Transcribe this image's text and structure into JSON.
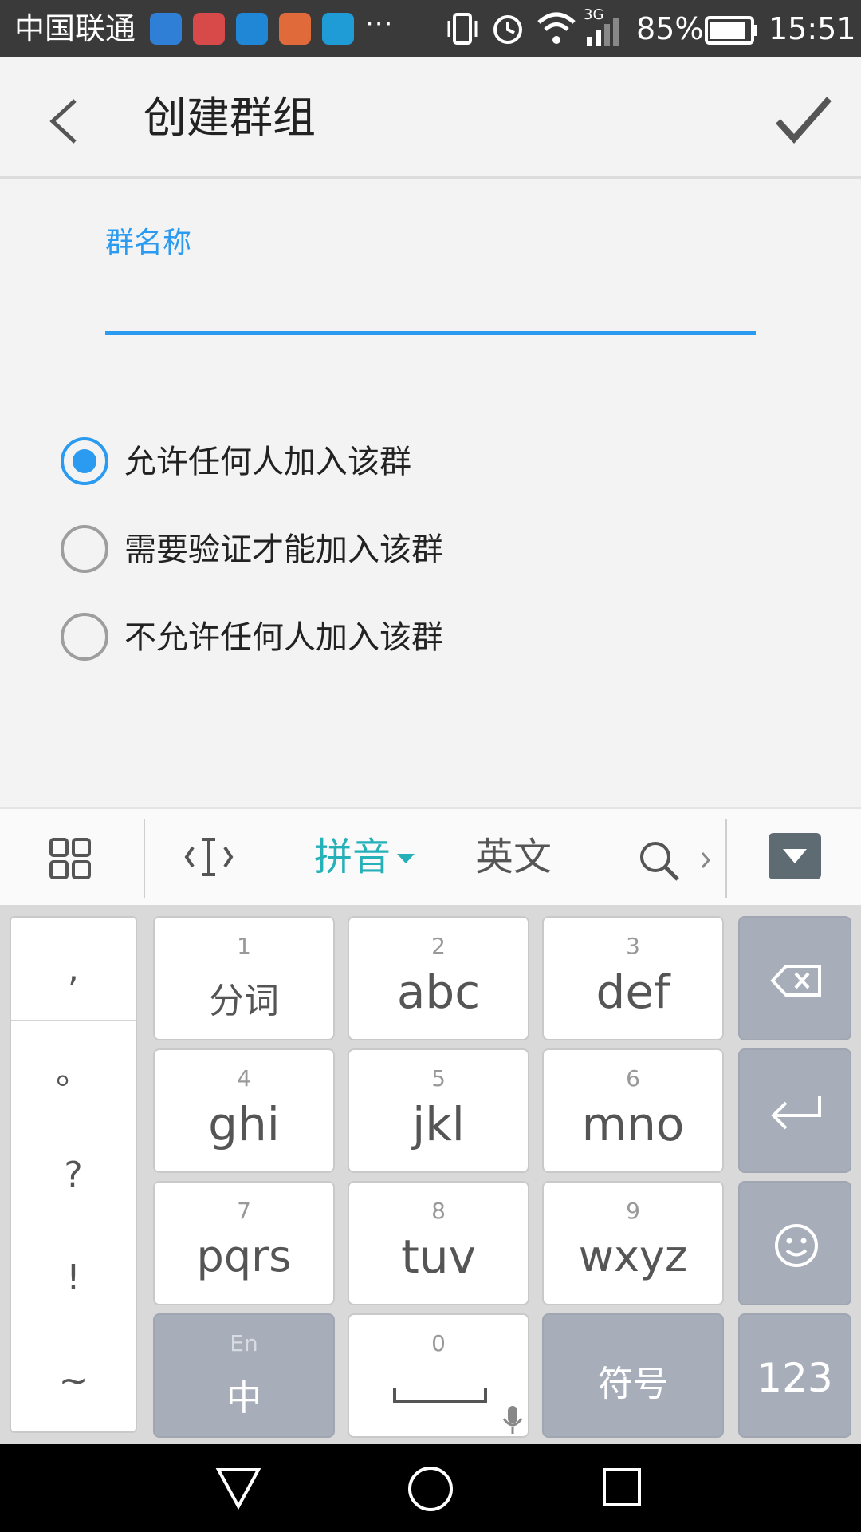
{
  "status_bar": {
    "carrier": "中国联通",
    "more": "···",
    "network": "3G",
    "battery": "85%",
    "time": "15:51",
    "icon_colors": [
      "#2f7fd6",
      "#d84a4a",
      "#1f87d6",
      "#e06a3a",
      "#1f9bd6"
    ]
  },
  "app_bar": {
    "back_icon": "back-arrow-icon",
    "title": "创建群组",
    "confirm_icon": "check-icon"
  },
  "form": {
    "name_label": "群名称",
    "name_value": "",
    "accent_color": "#2a9bf0"
  },
  "options": [
    {
      "label": "允许任何人加入该群",
      "selected": true
    },
    {
      "label": "需要验证才能加入该群",
      "selected": false
    },
    {
      "label": "不允许任何人加入该群",
      "selected": false
    }
  ],
  "ime_toolbar": {
    "tabs": [
      "拼音",
      "英文"
    ],
    "active_tab": "拼音",
    "active_color": "#26b0b8"
  },
  "keyboard": {
    "side_keys": [
      ",",
      "。",
      "?",
      "!",
      "~"
    ],
    "keys": [
      {
        "num": "1",
        "label": "分词"
      },
      {
        "num": "2",
        "label": "abc"
      },
      {
        "num": "3",
        "label": "def"
      },
      {
        "num": "4",
        "label": "ghi"
      },
      {
        "num": "5",
        "label": "jkl"
      },
      {
        "num": "6",
        "label": "mno"
      },
      {
        "num": "7",
        "label": "pqrs"
      },
      {
        "num": "8",
        "label": "tuv"
      },
      {
        "num": "9",
        "label": "wxyz"
      }
    ],
    "lang_toggle_top": "En",
    "lang_toggle_main": "中",
    "space_num": "0",
    "symbols": "符号",
    "numbers": "123"
  }
}
